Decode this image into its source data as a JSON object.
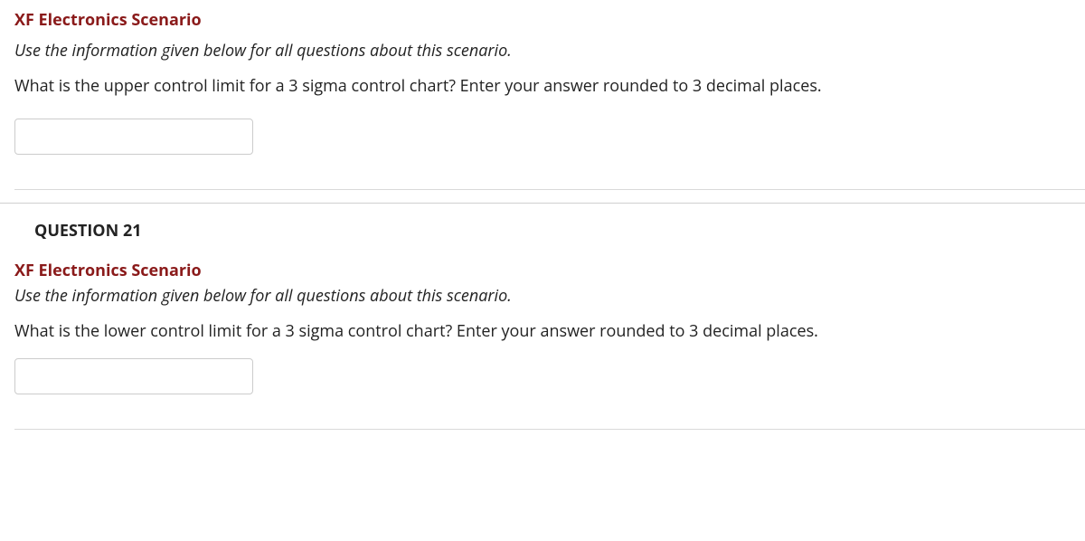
{
  "question20": {
    "scenario_title": "XF Electronics Scenario",
    "scenario_instruction": "Use the information given below for all questions about this scenario.",
    "question_text": "What is the upper control limit for a 3 sigma control chart? Enter your answer rounded to 3 decimal places.",
    "answer_value": ""
  },
  "question21": {
    "header": "QUESTION 21",
    "scenario_title": "XF Electronics Scenario",
    "scenario_instruction": "Use the information given below for all questions about this scenario.",
    "question_text": "What is the lower control limit for a 3 sigma control chart? Enter your answer rounded to 3 decimal places.",
    "answer_value": ""
  }
}
